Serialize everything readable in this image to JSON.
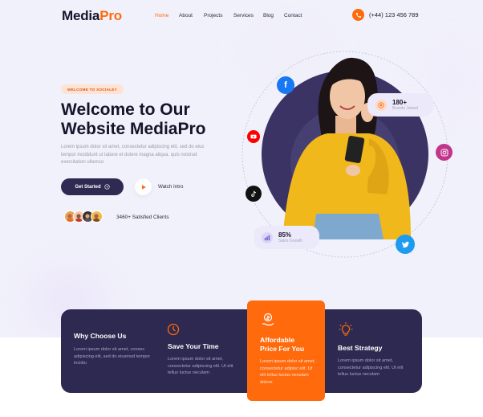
{
  "brand": {
    "name_main": "Media",
    "name_accent": "Pro"
  },
  "nav": {
    "items": [
      {
        "label": "Home",
        "active": true
      },
      {
        "label": "About",
        "active": false
      },
      {
        "label": "Projects",
        "active": false
      },
      {
        "label": "Services",
        "active": false
      },
      {
        "label": "Blog",
        "active": false
      },
      {
        "label": "Contact",
        "active": false
      }
    ],
    "phone": "(+44) 123 456 789"
  },
  "hero": {
    "badge": "WELCOME TO SOCIALEY",
    "title_line1": "Welcome to Our",
    "title_line2": "Website MediaPro",
    "description": "Lorem ipsum dolor sit amet, consectetur adipiscing elit, sed do eius tempor incididunt ut labore et dolore magna aliqua. quis nostrud exercitation ullamco",
    "cta_label": "Get Started",
    "watch_label": "Watch Intro",
    "clients_label": "3460+ Satisfied Clients"
  },
  "stats": {
    "brands_value": "180+",
    "brands_label": "Brands Joined",
    "sales_value": "85%",
    "sales_label": "Sales Growth"
  },
  "social_icons": [
    "facebook-icon",
    "youtube-icon",
    "tiktok-icon",
    "instagram-icon",
    "twitter-icon"
  ],
  "features": [
    {
      "title": "Why Choose Us",
      "desc": "Lorem ipsum dolor sit amet, consec adipiscing elit, sed do eiusmod tempor incidiu"
    },
    {
      "title": "Save Your Time",
      "desc": "Lorem ipsum dolor sit amet, consectetur adipiscing elit. Ut elit tellus luctus neculam"
    },
    {
      "title_line1": "Affordable",
      "title_line2": "Price For You",
      "desc": "Lorem ipsum dolor sit amet, consectetur adipisc elit. Ut elit tellus luctus neculam dolore"
    },
    {
      "title": "Best Strategy",
      "desc": "Lorem ipsum dolor sit amet, consectetur adipiscing elit. Ut elit tellus luctus neculam"
    }
  ],
  "colors": {
    "accent": "#ff6a0d",
    "dark": "#2e2950",
    "bg": "#f1f1fb"
  }
}
